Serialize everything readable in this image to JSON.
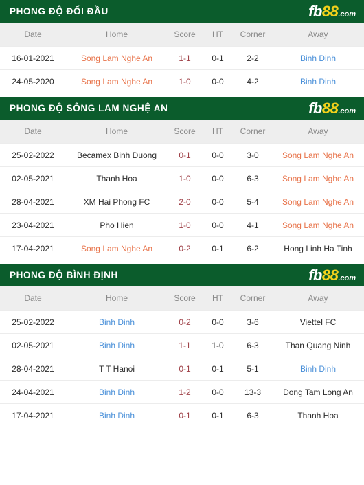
{
  "logo": {
    "part1": "fb",
    "part2": "88",
    "part3": ".com",
    "accent_color": "#f2d11b"
  },
  "theme": {
    "banner_bg": "#0b5c2c",
    "header_row_bg": "#eeeeee",
    "score_color": "#9e3f46",
    "team_orange": "#e8734a",
    "team_blue": "#4a90d9"
  },
  "columns": {
    "date": "Date",
    "home": "Home",
    "score": "Score",
    "ht": "HT",
    "corner": "Corner",
    "away": "Away"
  },
  "sections": [
    {
      "title": "PHONG ĐỘ ĐỐI ĐẦU",
      "rows": [
        {
          "date": "16-01-2021",
          "home": "Song Lam Nghe An",
          "home_style": "orange",
          "score": "1-1",
          "ht": "0-1",
          "corner": "2-2",
          "away": "Binh Dinh",
          "away_style": "blue"
        },
        {
          "date": "24-05-2020",
          "home": "Song Lam Nghe An",
          "home_style": "orange",
          "score": "1-0",
          "ht": "0-0",
          "corner": "4-2",
          "away": "Binh Dinh",
          "away_style": "blue"
        }
      ]
    },
    {
      "title": "PHONG ĐỘ SÔNG LAM NGHỆ AN",
      "rows": [
        {
          "date": "25-02-2022",
          "home": "Becamex Binh Duong",
          "home_style": "dark",
          "score": "0-1",
          "ht": "0-0",
          "corner": "3-0",
          "away": "Song Lam Nghe An",
          "away_style": "orange"
        },
        {
          "date": "02-05-2021",
          "home": "Thanh Hoa",
          "home_style": "dark",
          "score": "1-0",
          "ht": "0-0",
          "corner": "6-3",
          "away": "Song Lam Nghe An",
          "away_style": "orange"
        },
        {
          "date": "28-04-2021",
          "home": "XM Hai Phong FC",
          "home_style": "dark",
          "score": "2-0",
          "ht": "0-0",
          "corner": "5-4",
          "away": "Song Lam Nghe An",
          "away_style": "orange"
        },
        {
          "date": "23-04-2021",
          "home": "Pho Hien",
          "home_style": "dark",
          "score": "1-0",
          "ht": "0-0",
          "corner": "4-1",
          "away": "Song Lam Nghe An",
          "away_style": "orange"
        },
        {
          "date": "17-04-2021",
          "home": "Song Lam Nghe An",
          "home_style": "orange",
          "score": "0-2",
          "ht": "0-1",
          "corner": "6-2",
          "away": "Hong Linh Ha Tinh",
          "away_style": "dark"
        }
      ]
    },
    {
      "title": "PHONG ĐỘ BÌNH ĐỊNH",
      "rows": [
        {
          "date": "25-02-2022",
          "home": "Binh Dinh",
          "home_style": "blue",
          "score": "0-2",
          "ht": "0-0",
          "corner": "3-6",
          "away": "Viettel FC",
          "away_style": "dark"
        },
        {
          "date": "02-05-2021",
          "home": "Binh Dinh",
          "home_style": "blue",
          "score": "1-1",
          "ht": "1-0",
          "corner": "6-3",
          "away": "Than Quang Ninh",
          "away_style": "dark"
        },
        {
          "date": "28-04-2021",
          "home": "T T Hanoi",
          "home_style": "dark",
          "score": "0-1",
          "ht": "0-1",
          "corner": "5-1",
          "away": "Binh Dinh",
          "away_style": "blue"
        },
        {
          "date": "24-04-2021",
          "home": "Binh Dinh",
          "home_style": "blue",
          "score": "1-2",
          "ht": "0-0",
          "corner": "13-3",
          "away": "Dong Tam Long An",
          "away_style": "dark"
        },
        {
          "date": "17-04-2021",
          "home": "Binh Dinh",
          "home_style": "blue",
          "score": "0-1",
          "ht": "0-1",
          "corner": "6-3",
          "away": "Thanh Hoa",
          "away_style": "dark"
        }
      ]
    }
  ]
}
